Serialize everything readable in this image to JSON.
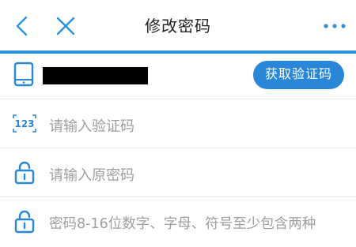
{
  "nav": {
    "title": "修改密码",
    "back_icon": "chevron-left-icon",
    "close_icon": "close-icon",
    "more_icon": "more-dots-icon"
  },
  "colors": {
    "accent": "#2a93e0",
    "button": "#2a86d9",
    "placeholder": "#9e9e9e"
  },
  "form": {
    "phone": {
      "icon": "phone-icon",
      "redacted": true
    },
    "get_code_button": "获取验证码",
    "code_field": {
      "icon": "number-123-icon",
      "placeholder": "请输入验证码"
    },
    "old_password": {
      "icon": "lock-icon",
      "placeholder": "请输入原密码"
    },
    "new_password": {
      "icon": "lock-icon",
      "placeholder": "密码8-16位数字、字母、符号至少包含两种"
    }
  }
}
